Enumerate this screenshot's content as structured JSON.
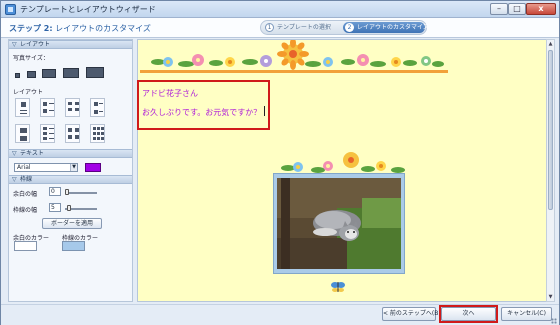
{
  "window": {
    "title": "テンプレートとレイアウトウィザード",
    "controls": {
      "minimize": "–",
      "maximize": "□",
      "close": "x"
    }
  },
  "step": {
    "prefix": "ステップ 2:",
    "title": "レイアウトのカスタマイズ",
    "stepper": [
      {
        "num": "1",
        "label": "テンプレートの選択",
        "active": false
      },
      {
        "num": "2",
        "label": "レイアウトのカスタマイズ",
        "active": true
      }
    ]
  },
  "sidebar": {
    "layout_section": {
      "header": "レイアウト",
      "photo_size_label": "写真サイズ：",
      "photo_sizes": [
        "size-xs",
        "size-s",
        "size-m",
        "size-l",
        "size-xl"
      ],
      "layout_label": "レイアウト"
    },
    "text_section": {
      "header": "テキスト",
      "font_value": "Arial",
      "font_color": "#a100e6"
    },
    "border_section": {
      "header": "枠線",
      "margin_width_label": "余白の幅",
      "margin_width_value": "0",
      "border_width_label": "枠線の幅",
      "border_width_value": "5",
      "apply_border_button": "ボーダーを適用",
      "margin_color_label": "余白のカラー",
      "border_color_label": "枠線のカラー",
      "margin_color": "#ffffff",
      "border_color": "#a6c9ea"
    }
  },
  "canvas": {
    "background": "#ffffc4",
    "greeting": "アドビ花子さん",
    "message": "お久しぶりです。お元気ですか？"
  },
  "footer": {
    "back_button": "< 前のステップへ(B)",
    "next_button": "次へ",
    "cancel_button": "キャンセル(C)"
  },
  "colors": {
    "accent": "#3f73b5",
    "highlight_box": "#d01a1a",
    "text_purple": "#b020d8"
  }
}
